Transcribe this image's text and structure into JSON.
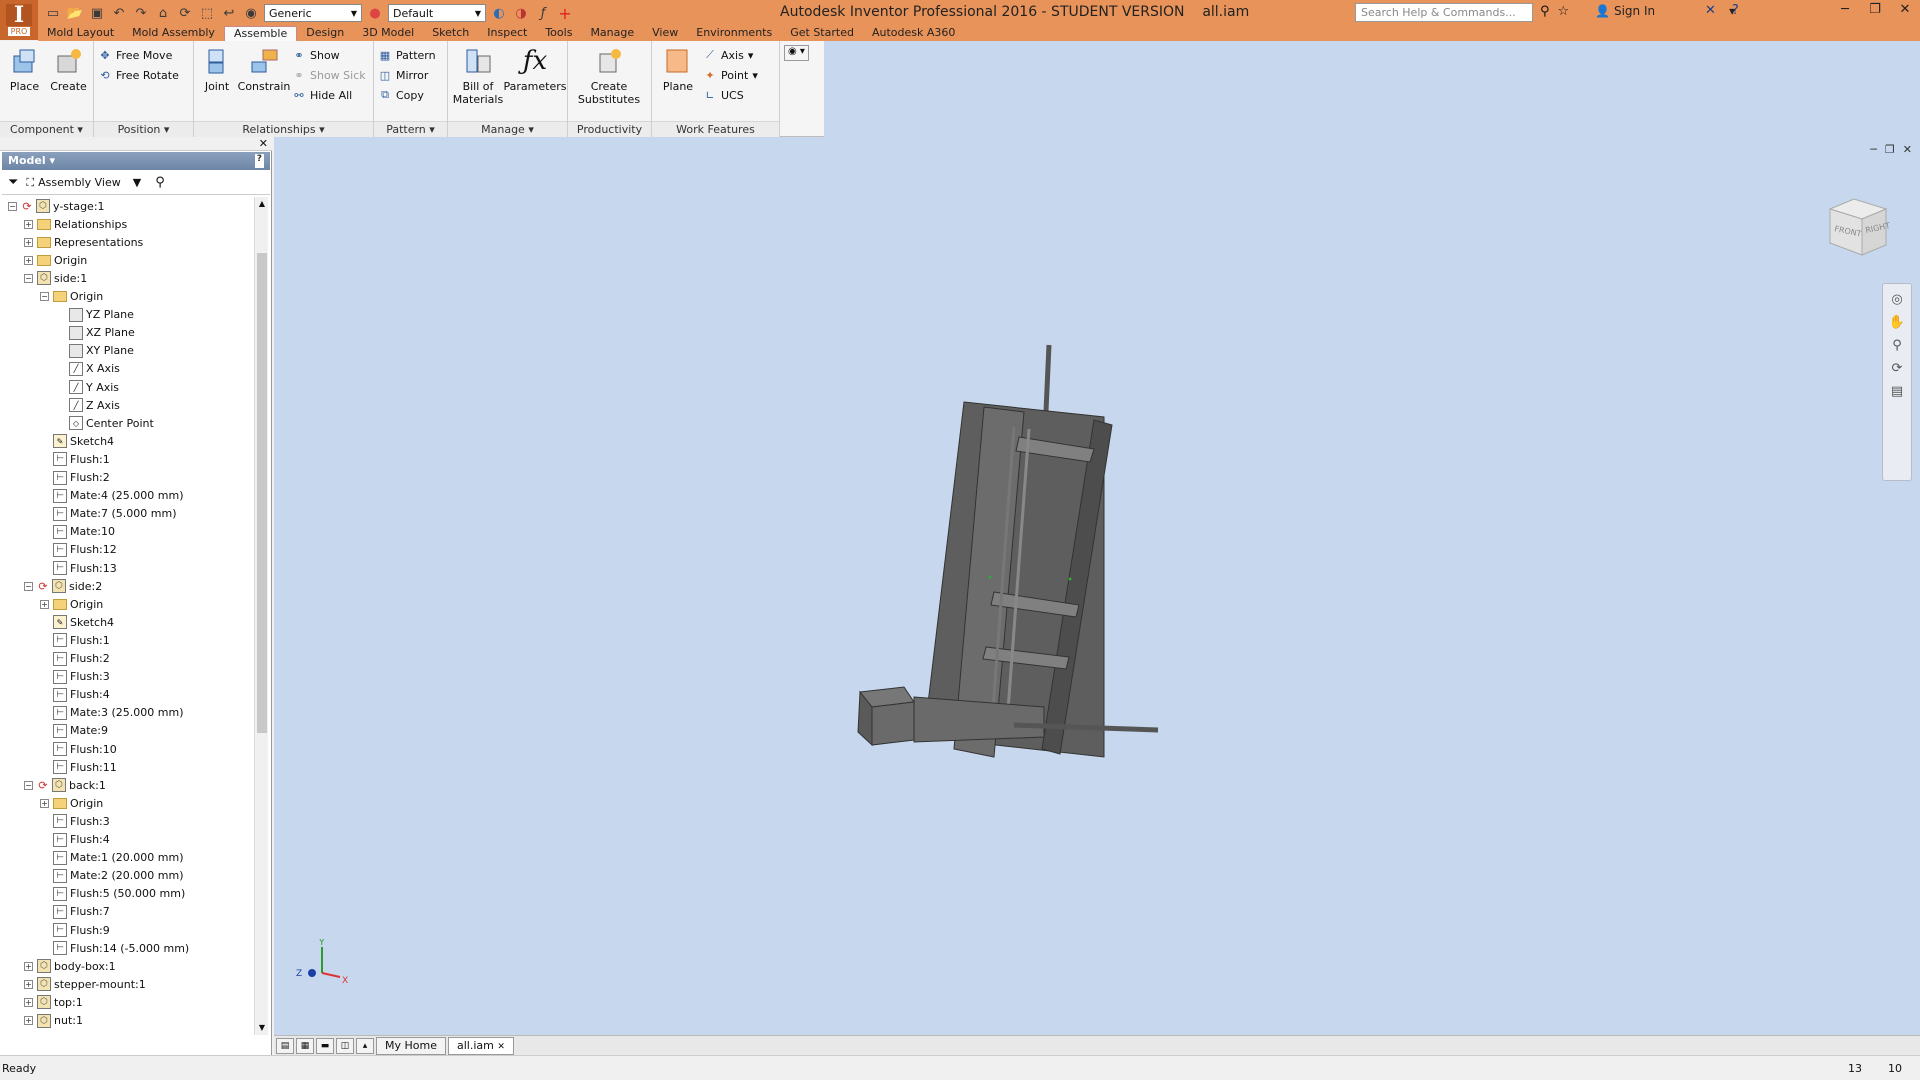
{
  "app": {
    "title": "Autodesk Inventor Professional 2016 - STUDENT VERSION",
    "filename": "all.iam",
    "app_button_letter": "I",
    "app_button_badge": "PRO",
    "material_value": "Generic",
    "appearance_value": "Default",
    "search_placeholder": "Search Help & Commands...",
    "sign_in": "Sign In",
    "accent_color": "#e8935a"
  },
  "tabs": [
    "Mold Layout",
    "Mold Assembly",
    "Assemble",
    "Design",
    "3D Model",
    "Sketch",
    "Inspect",
    "Tools",
    "Manage",
    "View",
    "Environments",
    "Get Started",
    "Autodesk A360"
  ],
  "active_tab": "Assemble",
  "ribbon": {
    "component": {
      "title": "Component",
      "place": "Place",
      "create": "Create"
    },
    "position": {
      "title": "Position",
      "free_move": "Free Move",
      "free_rotate": "Free Rotate"
    },
    "relationships": {
      "title": "Relationships",
      "joint": "Joint",
      "constrain": "Constrain",
      "show": "Show",
      "show_sick": "Show Sick",
      "hide_all": "Hide All"
    },
    "pattern": {
      "title": "Pattern",
      "pattern": "Pattern",
      "mirror": "Mirror",
      "copy": "Copy"
    },
    "manage": {
      "title": "Manage",
      "bom_line1": "Bill of",
      "bom_line2": "Materials",
      "parameters": "Parameters"
    },
    "productivity": {
      "title": "Productivity",
      "line1": "Create",
      "line2": "Substitutes"
    },
    "work_features": {
      "title": "Work Features",
      "plane": "Plane",
      "axis": "Axis",
      "point": "Point",
      "ucs": "UCS"
    }
  },
  "browser": {
    "title": "Model",
    "view": "Assembly View",
    "tree": [
      {
        "label": "y-stage:1",
        "indent": 0,
        "exp": "-",
        "icon": "sync-part"
      },
      {
        "label": "Relationships",
        "indent": 1,
        "exp": "+",
        "icon": "folder"
      },
      {
        "label": "Representations",
        "indent": 1,
        "exp": "+",
        "icon": "folder"
      },
      {
        "label": "Origin",
        "indent": 1,
        "exp": "+",
        "icon": "folder"
      },
      {
        "label": "side:1",
        "indent": 1,
        "exp": "-",
        "icon": "part"
      },
      {
        "label": "Origin",
        "indent": 2,
        "exp": "-",
        "icon": "folder"
      },
      {
        "label": "YZ Plane",
        "indent": 3,
        "exp": "",
        "icon": "plane"
      },
      {
        "label": "XZ Plane",
        "indent": 3,
        "exp": "",
        "icon": "plane"
      },
      {
        "label": "XY Plane",
        "indent": 3,
        "exp": "",
        "icon": "plane"
      },
      {
        "label": "X Axis",
        "indent": 3,
        "exp": "",
        "icon": "axis"
      },
      {
        "label": "Y Axis",
        "indent": 3,
        "exp": "",
        "icon": "axis"
      },
      {
        "label": "Z Axis",
        "indent": 3,
        "exp": "",
        "icon": "axis"
      },
      {
        "label": "Center Point",
        "indent": 3,
        "exp": "",
        "icon": "point"
      },
      {
        "label": "Sketch4",
        "indent": 2,
        "exp": "",
        "icon": "sketch"
      },
      {
        "label": "Flush:1",
        "indent": 2,
        "exp": "",
        "icon": "constraint"
      },
      {
        "label": "Flush:2",
        "indent": 2,
        "exp": "",
        "icon": "constraint"
      },
      {
        "label": "Mate:4 (25.000 mm)",
        "indent": 2,
        "exp": "",
        "icon": "constraint"
      },
      {
        "label": "Mate:7 (5.000 mm)",
        "indent": 2,
        "exp": "",
        "icon": "constraint"
      },
      {
        "label": "Mate:10",
        "indent": 2,
        "exp": "",
        "icon": "constraint"
      },
      {
        "label": "Flush:12",
        "indent": 2,
        "exp": "",
        "icon": "constraint"
      },
      {
        "label": "Flush:13",
        "indent": 2,
        "exp": "",
        "icon": "constraint"
      },
      {
        "label": "side:2",
        "indent": 1,
        "exp": "-",
        "icon": "sync-part"
      },
      {
        "label": "Origin",
        "indent": 2,
        "exp": "+",
        "icon": "folder"
      },
      {
        "label": "Sketch4",
        "indent": 2,
        "exp": "",
        "icon": "sketch"
      },
      {
        "label": "Flush:1",
        "indent": 2,
        "exp": "",
        "icon": "constraint"
      },
      {
        "label": "Flush:2",
        "indent": 2,
        "exp": "",
        "icon": "constraint"
      },
      {
        "label": "Flush:3",
        "indent": 2,
        "exp": "",
        "icon": "constraint"
      },
      {
        "label": "Flush:4",
        "indent": 2,
        "exp": "",
        "icon": "constraint"
      },
      {
        "label": "Mate:3 (25.000 mm)",
        "indent": 2,
        "exp": "",
        "icon": "constraint"
      },
      {
        "label": "Mate:9",
        "indent": 2,
        "exp": "",
        "icon": "constraint"
      },
      {
        "label": "Flush:10",
        "indent": 2,
        "exp": "",
        "icon": "constraint"
      },
      {
        "label": "Flush:11",
        "indent": 2,
        "exp": "",
        "icon": "constraint"
      },
      {
        "label": "back:1",
        "indent": 1,
        "exp": "-",
        "icon": "sync-part"
      },
      {
        "label": "Origin",
        "indent": 2,
        "exp": "+",
        "icon": "folder"
      },
      {
        "label": "Flush:3",
        "indent": 2,
        "exp": "",
        "icon": "constraint"
      },
      {
        "label": "Flush:4",
        "indent": 2,
        "exp": "",
        "icon": "constraint"
      },
      {
        "label": "Mate:1 (20.000 mm)",
        "indent": 2,
        "exp": "",
        "icon": "constraint"
      },
      {
        "label": "Mate:2 (20.000 mm)",
        "indent": 2,
        "exp": "",
        "icon": "constraint"
      },
      {
        "label": "Flush:5 (50.000 mm)",
        "indent": 2,
        "exp": "",
        "icon": "constraint"
      },
      {
        "label": "Flush:7",
        "indent": 2,
        "exp": "",
        "icon": "constraint"
      },
      {
        "label": "Flush:9",
        "indent": 2,
        "exp": "",
        "icon": "constraint"
      },
      {
        "label": "Flush:14 (-5.000 mm)",
        "indent": 2,
        "exp": "",
        "icon": "constraint"
      },
      {
        "label": "body-box:1",
        "indent": 1,
        "exp": "+",
        "icon": "part"
      },
      {
        "label": "stepper-mount:1",
        "indent": 1,
        "exp": "+",
        "icon": "part"
      },
      {
        "label": "top:1",
        "indent": 1,
        "exp": "+",
        "icon": "part"
      },
      {
        "label": "nut:1",
        "indent": 1,
        "exp": "+",
        "icon": "part"
      }
    ]
  },
  "viewcube": {
    "front": "FRONT",
    "right": "RIGHT"
  },
  "triad": {
    "x": "X",
    "y": "Y",
    "z": "Z"
  },
  "doc_tabs": [
    "My Home",
    "all.iam"
  ],
  "status": {
    "text": "Ready",
    "a": "13",
    "b": "10"
  }
}
